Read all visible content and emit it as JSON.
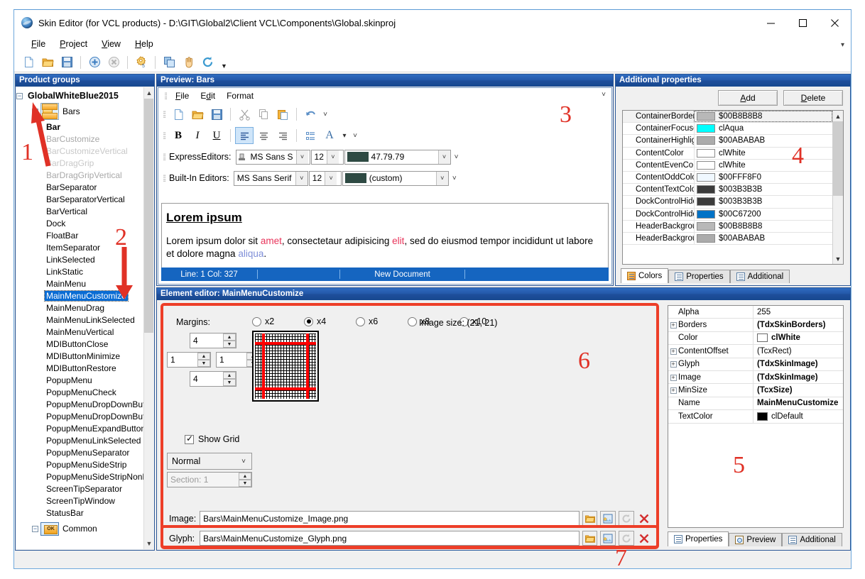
{
  "window": {
    "title": "Skin Editor (for VCL products) - D:\\GIT\\Global2\\Client VCL\\Components\\Global.skinproj",
    "minimize_label": "–",
    "maximize_label": "□",
    "close_label": "✕"
  },
  "menubar": [
    {
      "label": "File",
      "accel": "F"
    },
    {
      "label": "Project",
      "accel": "P"
    },
    {
      "label": "View",
      "accel": "V"
    },
    {
      "label": "Help",
      "accel": "H"
    }
  ],
  "toolbar": {
    "icons": [
      "new-document-icon",
      "open-folder-icon",
      "save-disk-icon",
      "add-circle-icon",
      "delete-circle-icon",
      "gears-icon",
      "copy-icon",
      "hand-icon",
      "refresh-icon"
    ],
    "overflow_label": "▾"
  },
  "product_groups": {
    "caption": "Product groups",
    "root": "GlobalWhiteBlue2015",
    "group": "Bars",
    "items": [
      {
        "label": "Bar",
        "style": "bold"
      },
      {
        "label": "BarCustomize",
        "style": "dim"
      },
      {
        "label": "BarCustomizeVertical",
        "style": "dim2"
      },
      {
        "label": "BarDragGrip",
        "style": "dim2"
      },
      {
        "label": "BarDragGripVertical",
        "style": "dim"
      },
      {
        "label": "BarSeparator",
        "style": "normal"
      },
      {
        "label": "BarSeparatorVertical",
        "style": "normal"
      },
      {
        "label": "BarVertical",
        "style": "normal"
      },
      {
        "label": "Dock",
        "style": "normal"
      },
      {
        "label": "FloatBar",
        "style": "normal"
      },
      {
        "label": "ItemSeparator",
        "style": "normal"
      },
      {
        "label": "LinkSelected",
        "style": "normal"
      },
      {
        "label": "LinkStatic",
        "style": "normal"
      },
      {
        "label": "MainMenu",
        "style": "normal"
      },
      {
        "label": "MainMenuCustomize",
        "style": "selected"
      },
      {
        "label": "MainMenuDrag",
        "style": "normal"
      },
      {
        "label": "MainMenuLinkSelected",
        "style": "normal"
      },
      {
        "label": "MainMenuVertical",
        "style": "normal"
      },
      {
        "label": "MDIButtonClose",
        "style": "normal"
      },
      {
        "label": "MDIButtonMinimize",
        "style": "normal"
      },
      {
        "label": "MDIButtonRestore",
        "style": "normal"
      },
      {
        "label": "PopupMenu",
        "style": "normal"
      },
      {
        "label": "PopupMenuCheck",
        "style": "normal"
      },
      {
        "label": "PopupMenuDropDownButt",
        "style": "normal"
      },
      {
        "label": "PopupMenuDropDownButt",
        "style": "normal"
      },
      {
        "label": "PopupMenuExpandButton",
        "style": "normal"
      },
      {
        "label": "PopupMenuLinkSelected",
        "style": "normal"
      },
      {
        "label": "PopupMenuSeparator",
        "style": "normal"
      },
      {
        "label": "PopupMenuSideStrip",
        "style": "normal"
      },
      {
        "label": "PopupMenuSideStripNonR",
        "style": "normal"
      },
      {
        "label": "ScreenTipSeparator",
        "style": "normal"
      },
      {
        "label": "ScreenTipWindow",
        "style": "normal"
      },
      {
        "label": "StatusBar",
        "style": "normal"
      }
    ],
    "common": "Common"
  },
  "preview": {
    "caption": "Preview: Bars",
    "menu": [
      {
        "label": "File",
        "accel": "F"
      },
      {
        "label": "Edit",
        "accel": "d"
      },
      {
        "label": "Format",
        "accel": ""
      }
    ],
    "expand_chevron": "˅",
    "express_label": "ExpressEditors:",
    "builtin_label": "Built-In Editors:",
    "express_font": "MS Sans S",
    "express_size": "12",
    "express_color_text": "47.79.79",
    "express_color_hex": "#2e4a43",
    "builtin_font": "MS Sans Serif",
    "builtin_size": "12",
    "builtin_color_text": "(custom)",
    "builtin_color_hex": "#2e4a43",
    "doc_heading": "Lorem ipsum",
    "doc_body_1": "Lorem ipsum dolor sit ",
    "doc_body_amet": "amet",
    "doc_body_2": ", consectetaur adipisicing ",
    "doc_body_elit": "elit",
    "doc_body_3": ", sed do eiusmod tempor incididunt ut labore et dolore magna ",
    "doc_body_aliqua": "aliqua",
    "doc_body_4": ".",
    "status_line": "Line:  1   Col: 327",
    "status_doc": "New Document"
  },
  "additional_properties": {
    "caption": "Additional properties",
    "add_label": "Add",
    "delete_label": "Delete",
    "rows": [
      {
        "name": "ContainerBorderC",
        "value": "$00B8B8B8",
        "color": "#b8b8b8"
      },
      {
        "name": "ContainerFocuse",
        "value": "clAqua",
        "color": "#00ffff"
      },
      {
        "name": "ContainerHighligh",
        "value": "$00ABABAB",
        "color": "#ababab"
      },
      {
        "name": "ContentColor",
        "value": "clWhite",
        "color": "#ffffff"
      },
      {
        "name": "ContentEvenColc",
        "value": "clWhite",
        "color": "#ffffff"
      },
      {
        "name": "ContentOddColor",
        "value": "$00FFF8F0",
        "color": "#f0f8ff"
      },
      {
        "name": "ContentTextColor",
        "value": "$003B3B3B",
        "color": "#3b3b3b"
      },
      {
        "name": "DockControlHidd",
        "value": "$003B3B3B",
        "color": "#3b3b3b"
      },
      {
        "name": "DockControlHidd",
        "value": "$00C67200",
        "color": "#0072c6"
      },
      {
        "name": "HeaderBackgrou",
        "value": "$00B8B8B8",
        "color": "#b8b8b8"
      },
      {
        "name": "HeaderBackgrou",
        "value": "$00ABABAB",
        "color": "#ababab"
      }
    ],
    "tabs": [
      {
        "label": "Colors",
        "icon": "palette-icon",
        "active": true
      },
      {
        "label": "Properties",
        "icon": "list-icon",
        "active": false
      },
      {
        "label": "Additional",
        "icon": "list-icon",
        "active": false
      }
    ]
  },
  "element_editor": {
    "caption": "Element editor: MainMenuCustomize",
    "margins_label": "Margins:",
    "margin_top": "4",
    "margin_left": "1",
    "margin_right": "1",
    "margin_bottom": "4",
    "zoom_options": [
      {
        "label": "x2",
        "selected": false
      },
      {
        "label": "x4",
        "selected": true
      },
      {
        "label": "x6",
        "selected": false
      },
      {
        "label": "x8",
        "selected": false
      },
      {
        "label": "x10",
        "selected": false
      }
    ],
    "image_size": "Image size: (21, 21)",
    "show_grid_label": "Show Grid",
    "show_grid_checked": true,
    "state_combo": "Normal",
    "section_spin": "Section: 1",
    "image_label": "Image:",
    "image_path": "Bars\\MainMenuCustomize_Image.png",
    "glyph_label": "Glyph:",
    "glyph_path": "Bars\\MainMenuCustomize_Glyph.png",
    "row_buttons": [
      "open-folder-icon",
      "save-as-image-icon",
      "refresh-icon",
      "clear-x-icon"
    ]
  },
  "properties": {
    "rows": [
      {
        "expand": false,
        "name": "Alpha",
        "value": "255",
        "bold": false,
        "swatch": null
      },
      {
        "expand": true,
        "name": "Borders",
        "value": "(TdxSkinBorders)",
        "bold": true,
        "swatch": null
      },
      {
        "expand": false,
        "name": "Color",
        "value": "clWhite",
        "bold": true,
        "swatch": "#ffffff"
      },
      {
        "expand": true,
        "name": "ContentOffset",
        "value": "(TcxRect)",
        "bold": false,
        "swatch": null
      },
      {
        "expand": true,
        "name": "Glyph",
        "value": "(TdxSkinImage)",
        "bold": true,
        "swatch": null
      },
      {
        "expand": true,
        "name": "Image",
        "value": "(TdxSkinImage)",
        "bold": true,
        "swatch": null
      },
      {
        "expand": true,
        "name": "MinSize",
        "value": "(TcxSize)",
        "bold": true,
        "swatch": null
      },
      {
        "expand": false,
        "name": "Name",
        "value": "MainMenuCustomize",
        "bold": true,
        "swatch": null
      },
      {
        "expand": false,
        "name": "TextColor",
        "value": "clDefault",
        "bold": false,
        "swatch": "#000000"
      }
    ],
    "tabs": [
      {
        "label": "Properties",
        "icon": "list-icon",
        "active": true
      },
      {
        "label": "Preview",
        "icon": "magnifier-icon",
        "active": false
      },
      {
        "label": "Additional",
        "icon": "list-icon",
        "active": false
      }
    ]
  },
  "annotations": {
    "n1": "1",
    "n2": "2",
    "n3": "3",
    "n4": "4",
    "n5": "5",
    "n6": "6",
    "n7": "7",
    "color": "#e03126"
  }
}
